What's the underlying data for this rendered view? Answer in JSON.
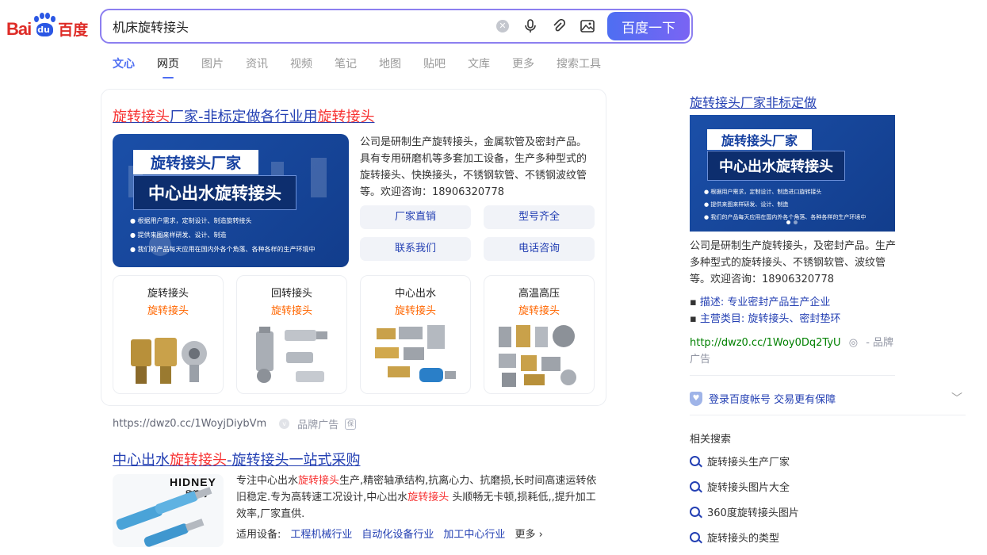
{
  "logo": {
    "bai": "Bai",
    "du": "du",
    "cn": "百度"
  },
  "search": {
    "query": "机床旋转接头",
    "button": "百度一下"
  },
  "tabs": [
    "文心",
    "网页",
    "图片",
    "资讯",
    "视频",
    "笔记",
    "地图",
    "贴吧",
    "文库",
    "更多",
    "搜索工具"
  ],
  "ad1": {
    "title_pre": "旋转接头",
    "title_mid": "厂家-非标定做各行业用",
    "title_post": "旋转接头",
    "banner": {
      "line1": "旋转接头厂家",
      "line2": "中心出水旋转接头",
      "bullets": [
        "根据用户需求，定制设计、制造旋转接头",
        "提供来图来样研发、设计、制造",
        "我们的产品每天应用在国内外各个角落、各种各样的生产环境中"
      ]
    },
    "desc": "公司是研制生产旋转接头，金属软管及密封产品。具有专用研磨机等多套加工设备，生产多种型式的旋转接头、快换接头，不锈钢软管、不锈钢波纹管等。欢迎咨询：18906320778",
    "buttons": [
      "厂家直销",
      "型号齐全",
      "联系我们",
      "电话咨询"
    ],
    "products": [
      {
        "name": "旋转接头",
        "sub": "旋转接头"
      },
      {
        "name": "回转接头",
        "sub": "旋转接头"
      },
      {
        "name": "中心出水",
        "sub": "旋转接头"
      },
      {
        "name": "高温高压",
        "sub": "旋转接头"
      }
    ],
    "url": "https://dwz0.cc/1WoyjDiybVm",
    "ad_label": "品牌广告",
    "bao": "保"
  },
  "result2": {
    "title_pre": "中心出水",
    "title_red": "旋转接头",
    "title_post": "-旋转接头一站式采购",
    "logo_en": "HIDNEY",
    "logo_cn": "欣德利",
    "desc_1": "专注中心出水",
    "desc_red1": "旋转接头",
    "desc_2": "生产,精密轴承结构,抗离心力、抗磨损,长时间高速运转依旧稳定.专为高转速工况设计,中心出水",
    "desc_red2": "旋转接头",
    "desc_3": " 头顺畅无卡顿,损耗低,,提升加工效率,厂家直供.",
    "links_label": "适用设备:",
    "links": [
      "工程机械行业",
      "自动化设备行业",
      "加工中心行业"
    ],
    "more": "更多"
  },
  "right": {
    "title": "旋转接头厂家非标定做",
    "banner": {
      "line1": "旋转接头厂家",
      "line2": "中心出水旋转接头",
      "bullets": [
        "根据用户需求，定制设计、制造进口旋转接头",
        "提供来图来样研发、设计、制造",
        "我们的产品每天应用在国内外各个角落、各种各样的生产环境中"
      ]
    },
    "desc": "公司是研制生产旋转接头，及密封产品。生产多种型式的旋转接头、不锈钢软管、波纹管等。欢迎咨询：18906320778",
    "meta_desc_label": "描述:",
    "meta_desc": "专业密封产品生产企业",
    "meta_cat_label": "主营类目:",
    "meta_cat": "旋转接头、密封垫环",
    "url": "http://dwz0.cc/1Woy0Dq2TyU",
    "ad_label": "- 品牌广告",
    "login": "登录百度帐号 交易更有保障",
    "related_title": "相关搜索",
    "related": [
      "旋转接头生产厂家",
      "旋转接头图片大全",
      "360度旋转接头图片",
      "旋转接头的类型"
    ]
  },
  "colors": {
    "accent": "#4e6ef2",
    "link": "#2440b3",
    "highlight": "#f73131",
    "sub_orange": "#ff6600"
  }
}
